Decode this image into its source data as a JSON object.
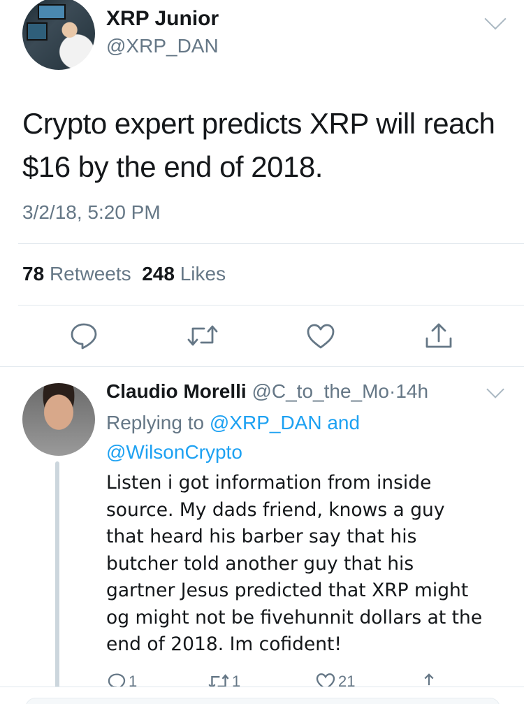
{
  "main_tweet": {
    "name": "XRP Junior",
    "handle": "@XRP_DAN",
    "text_line1": "Crypto expert predicts XRP will reach",
    "text_line2": "$16 by the end of 2018.",
    "timestamp": "3/2/18, 5:20 PM",
    "retweets_count": "78",
    "retweets_label": "Retweets",
    "likes_count": "248",
    "likes_label": "Likes"
  },
  "main_actions": [
    {
      "icon": "reply-icon"
    },
    {
      "icon": "retweet-icon"
    },
    {
      "icon": "like-icon"
    },
    {
      "icon": "share-icon"
    }
  ],
  "reply": {
    "name": "Claudio Morelli",
    "handle": "@C_to_the_Mo",
    "dot": "·",
    "time": "14h",
    "replying_prefix": "Replying to",
    "replying_user1": "@XRP_DAN",
    "replying_and": "and",
    "replying_user2": "@WilsonCrypto",
    "lines": [
      "Listen i got information from inside",
      "source. My dads friend, knows a guy",
      "that heard his barber say that his",
      "butcher told another guy that his",
      "gartner Jesus predicted that XRP might",
      "og might not be fivehunnit dollars at the",
      "end of 2018. Im cofident!"
    ],
    "reply_count": "1",
    "retweet_count": "1",
    "like_count": "21"
  },
  "colors": {
    "text": "#14171a",
    "secondary": "#657786",
    "link": "#1da1f2",
    "divider": "#e1e8ed"
  }
}
